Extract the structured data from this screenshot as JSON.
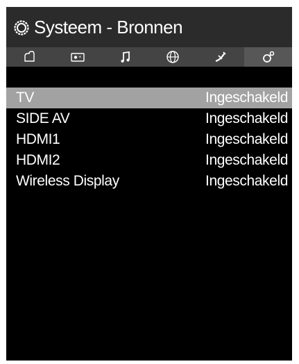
{
  "header": {
    "title": "Systeem - Bronnen",
    "icon": "gear-icon"
  },
  "tabs": [
    {
      "icon": "picture-icon",
      "active": false
    },
    {
      "icon": "sound-icon",
      "active": false
    },
    {
      "icon": "music-icon",
      "active": false
    },
    {
      "icon": "globe-icon",
      "active": false
    },
    {
      "icon": "satellite-icon",
      "active": false
    },
    {
      "icon": "settings-icon",
      "active": true
    }
  ],
  "sources": [
    {
      "name": "TV",
      "status": "Ingeschakeld",
      "selected": true
    },
    {
      "name": "SIDE AV",
      "status": "Ingeschakeld",
      "selected": false
    },
    {
      "name": "HDMI1",
      "status": "Ingeschakeld",
      "selected": false
    },
    {
      "name": "HDMI2",
      "status": "Ingeschakeld",
      "selected": false
    },
    {
      "name": "Wireless Display",
      "status": "Ingeschakeld",
      "selected": false
    }
  ]
}
